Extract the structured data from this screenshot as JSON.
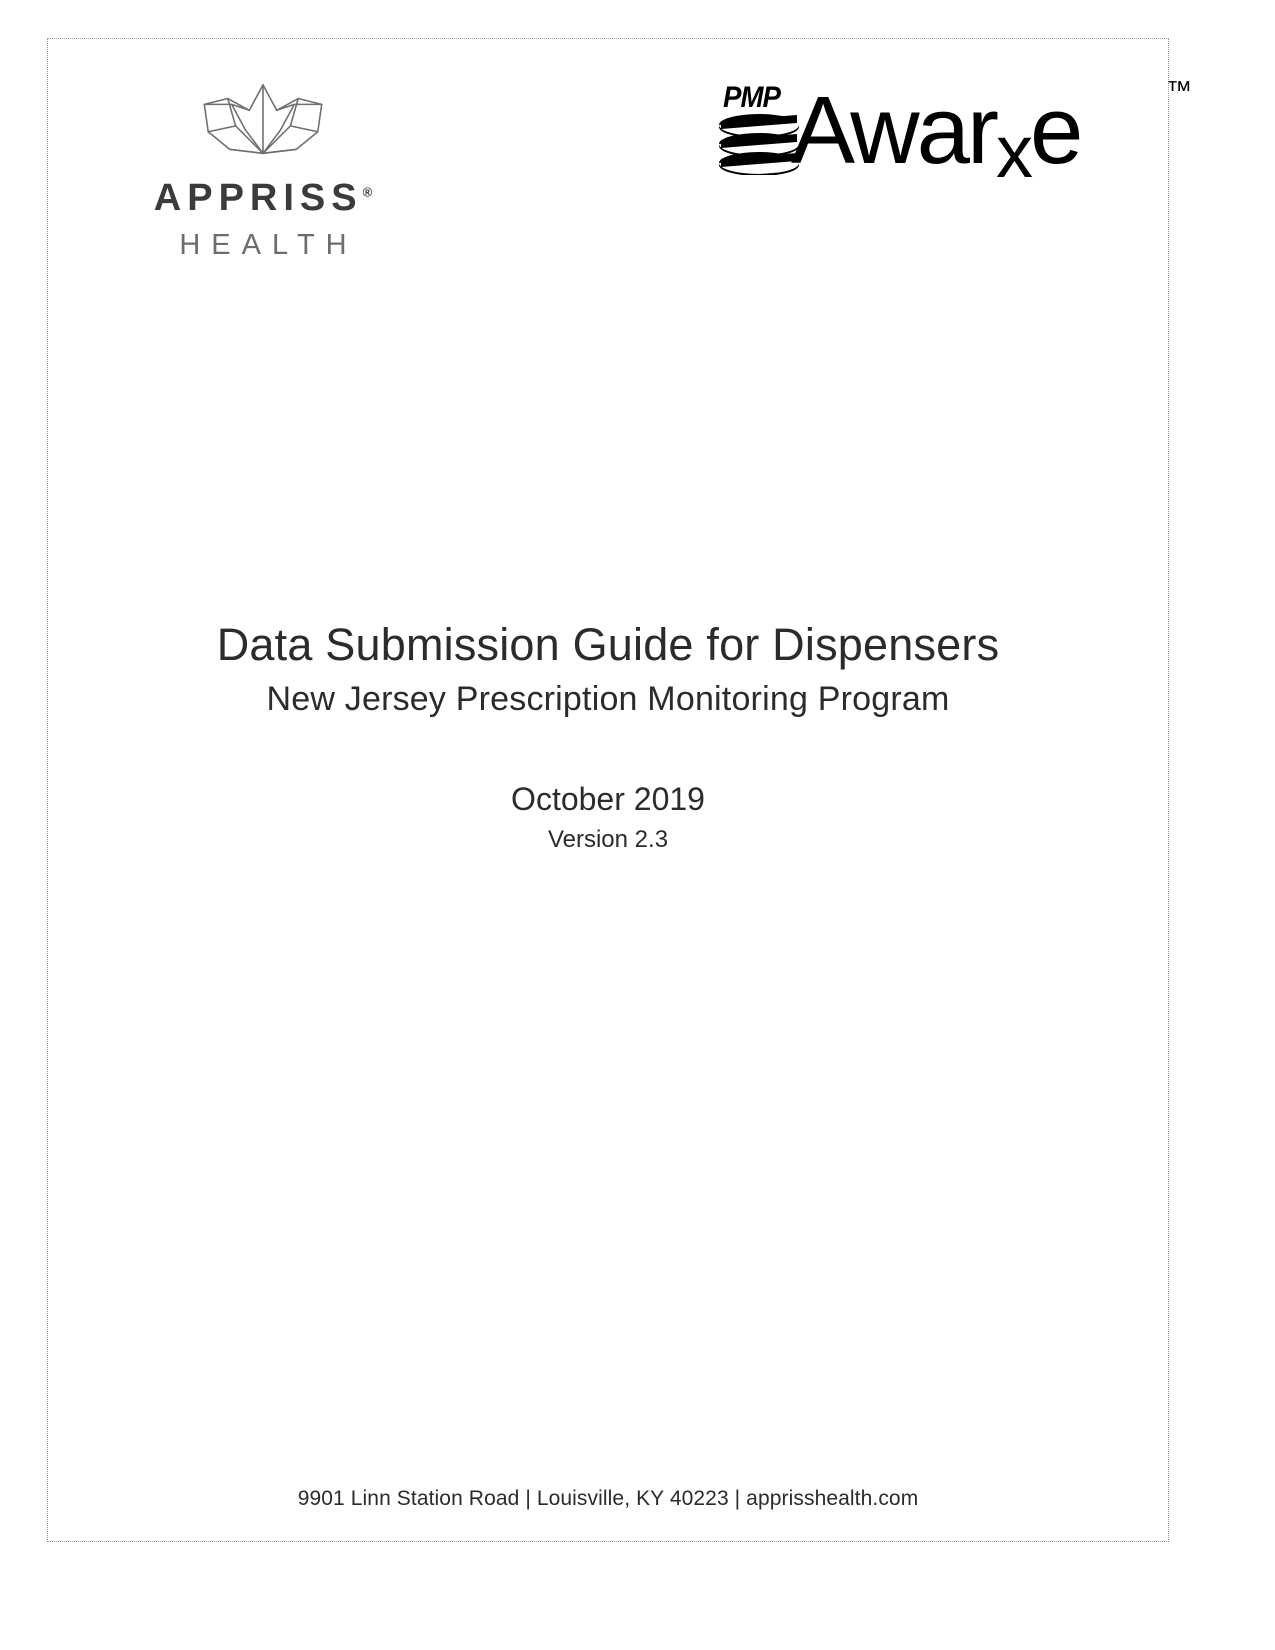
{
  "document": {
    "title": "Data Submission Guide for Dispensers",
    "subtitle": "New Jersey Prescription Monitoring Program",
    "date": "October 2019",
    "version": "Version 2.3"
  },
  "logos": {
    "appriss": {
      "wordmark": "APPRISS",
      "registered": "®",
      "tagline": "HEALTH",
      "mark_name": "lotus-crown-mark"
    },
    "pmp_awarxe": {
      "prefix": "PMP",
      "wordmark_part1": "Awar",
      "wordmark_x": "x",
      "wordmark_part2": "e",
      "trademark": "™",
      "mark_name": "stacked-bars-mark"
    }
  },
  "footer": {
    "text": "9901 Linn Station Road | Louisville, KY 40223 | apprisshealth.com"
  },
  "colors": {
    "text": "#2b2b2b",
    "appriss_word": "#3b3b3b",
    "appriss_tagline": "#6d6d6d",
    "page_border": "#9a9a9a",
    "background": "#ffffff"
  }
}
